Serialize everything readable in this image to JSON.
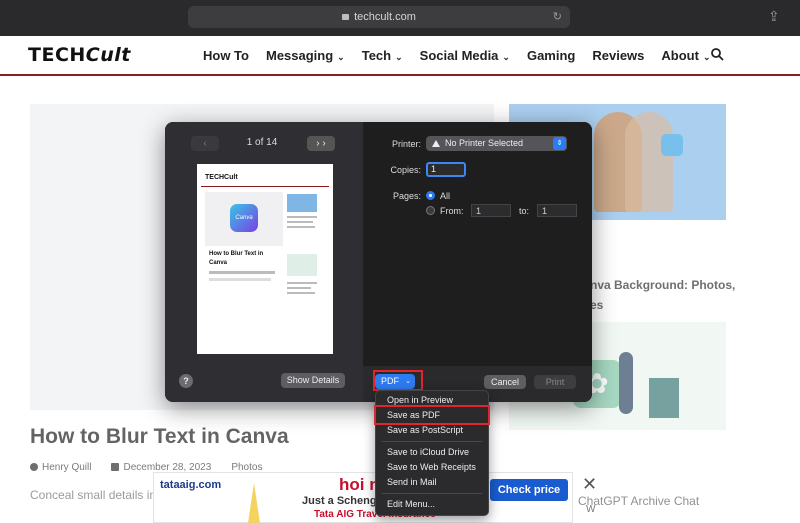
{
  "browser": {
    "url": "techcult.com"
  },
  "site": {
    "logo_left": "TECH",
    "logo_right": "Cult",
    "nav": [
      {
        "label": "How To",
        "has_menu": false
      },
      {
        "label": "Messaging",
        "has_menu": true
      },
      {
        "label": "Tech",
        "has_menu": true
      },
      {
        "label": "Social Media",
        "has_menu": true
      },
      {
        "label": "Gaming",
        "has_menu": false
      },
      {
        "label": "Reviews",
        "has_menu": false
      },
      {
        "label": "About",
        "has_menu": true
      }
    ]
  },
  "article": {
    "title": "How to Blur Text in Canva",
    "author": "Henry Quill",
    "date": "December 28, 2023",
    "category": "Photos",
    "excerpt": "Conceal small details in Canva"
  },
  "sidebar": {
    "post1_title_line1": "nva Background: Photos,",
    "post1_title_line2": "es",
    "post2_title": "ChatGPT Archive Chat"
  },
  "ad": {
    "brand": "tataaig.com",
    "headline": "hoi neth",
    "subline": "Just a Schengen",
    "tagline": "Tata AIG Travel Insurance",
    "cta": "Check price",
    "close": "✕",
    "tag": "W"
  },
  "print_dialog": {
    "page_indicator": "1 of 14",
    "prev_label": "‹",
    "next_label": "› ›",
    "thumbnail": {
      "logo": "TECHCult",
      "canva": "Canva",
      "title": "How to Blur Text in Canva"
    },
    "help": "?",
    "show_details": "Show Details",
    "printer_label": "Printer:",
    "printer_value": "No Printer Selected",
    "copies_label": "Copies:",
    "copies_value": "1",
    "pages_label": "Pages:",
    "pages_all": "All",
    "pages_from": "From:",
    "pages_from_value": "1",
    "pages_to": "to:",
    "pages_to_value": "1",
    "pdf_label": "PDF",
    "cancel_label": "Cancel",
    "print_label": "Print"
  },
  "pdf_menu": {
    "items": [
      "Open in Preview",
      "Save as PDF",
      "Save as PostScript",
      "Save to iCloud Drive",
      "Save to Web Receipts",
      "Send in Mail",
      "Edit Menu..."
    ],
    "selected": "Save as PDF"
  },
  "highlight_color": "#e0262b",
  "accent_color": "#2d7bf0"
}
